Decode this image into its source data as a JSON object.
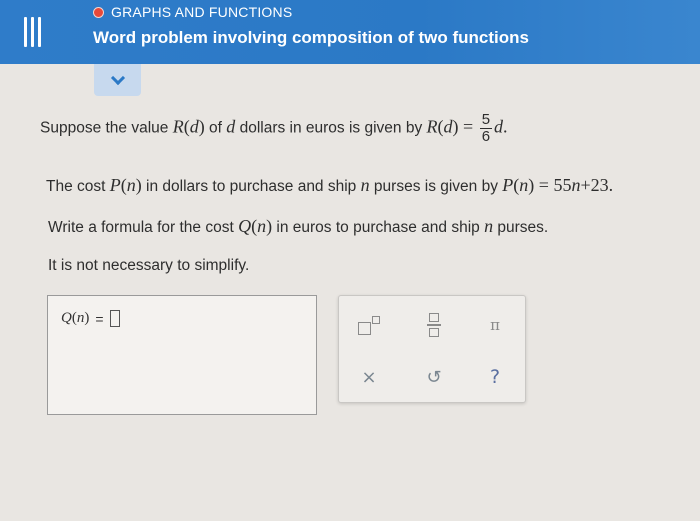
{
  "header": {
    "topic": "GRAPHS AND FUNCTIONS",
    "title": "Word problem involving composition of two functions"
  },
  "icons": {
    "menu": "hamburger-menu-icon",
    "topic_dot": "status-dot-icon",
    "collapse": "chevron-down-icon"
  },
  "colors": {
    "header_bg": "#2b79c6",
    "topic_dot": "#e8493a",
    "collapse_tab": "#c7d9ee"
  },
  "problem": {
    "line1_prefix": "Suppose the value ",
    "line1_fn": "R",
    "line1_arg": "d",
    "line1_mid1": " of ",
    "line1_var": "d",
    "line1_mid2": " dollars in euros is given by ",
    "line1_eq_fn": "R",
    "line1_eq_arg": "d",
    "line1_eq": " = ",
    "line1_num": "5",
    "line1_den": "6",
    "line1_tail": "d",
    "line1_end": ".",
    "line2_prefix": "The cost ",
    "line2_fn": "P",
    "line2_arg": "n",
    "line2_mid1": " in dollars to purchase and ship ",
    "line2_var": "n",
    "line2_mid2": " purses is given by ",
    "line2_eq_fn": "P",
    "line2_eq_arg": "n",
    "line2_eq_rhs": " = 55",
    "line2_eq_var": "n",
    "line2_eq_tail": "+23.",
    "line3_prefix": "Write a formula for the cost ",
    "line3_fn": "Q",
    "line3_arg": "n",
    "line3_mid": " in euros to purchase and ship ",
    "line3_var": "n",
    "line3_end": " purses.",
    "line4": "It is not necessary to simplify."
  },
  "answer": {
    "label_fn": "Q",
    "label_arg": "n",
    "label_eq": "="
  },
  "keypad": {
    "superscript": "superscript-icon",
    "fraction": "fraction-icon",
    "pi": "π",
    "clear": "×",
    "undo": "↺",
    "help": "?"
  }
}
